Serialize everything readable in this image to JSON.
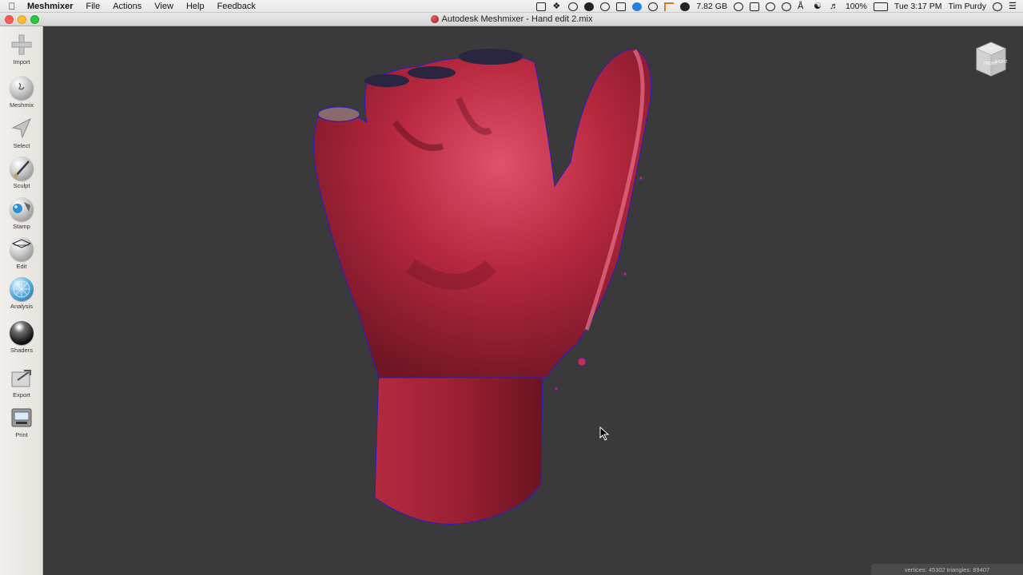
{
  "menubar": {
    "apple_icon": "apple-logo-icon",
    "items": [
      "Meshmixer",
      "File",
      "Actions",
      "View",
      "Help",
      "Feedback"
    ],
    "memory": "7.82 GB",
    "battery": "100%",
    "clock": "Tue 3:17 PM",
    "user": "Tim Purdy"
  },
  "window": {
    "title": "Autodesk Meshmixer - Hand edit 2.mix"
  },
  "toolbar": {
    "tools": [
      {
        "label": "Import",
        "icon": "import-plus-icon"
      },
      {
        "label": "Meshmix",
        "icon": "meshmix-sphere-icon"
      },
      {
        "label": "Select",
        "icon": "select-arrow-icon"
      },
      {
        "label": "Sculpt",
        "icon": "sculpt-brush-icon"
      },
      {
        "label": "Stamp",
        "icon": "stamp-icon"
      },
      {
        "label": "Edit",
        "icon": "edit-icon"
      },
      {
        "label": "Analysis",
        "icon": "analysis-icon"
      },
      {
        "label": "Shaders",
        "icon": "shaders-icon"
      },
      {
        "label": "Export",
        "icon": "export-icon"
      },
      {
        "label": "Print",
        "icon": "print-icon"
      }
    ]
  },
  "viewport": {
    "model": "hand mesh",
    "mesh_color": "#c03048",
    "edge_color": "#2a1ccc",
    "background": "#3a3a3a",
    "navcube": {
      "faces": [
        "FRONT",
        "RIGHT"
      ]
    }
  },
  "status": {
    "text": "vertices: 45302  triangles: 89407"
  }
}
